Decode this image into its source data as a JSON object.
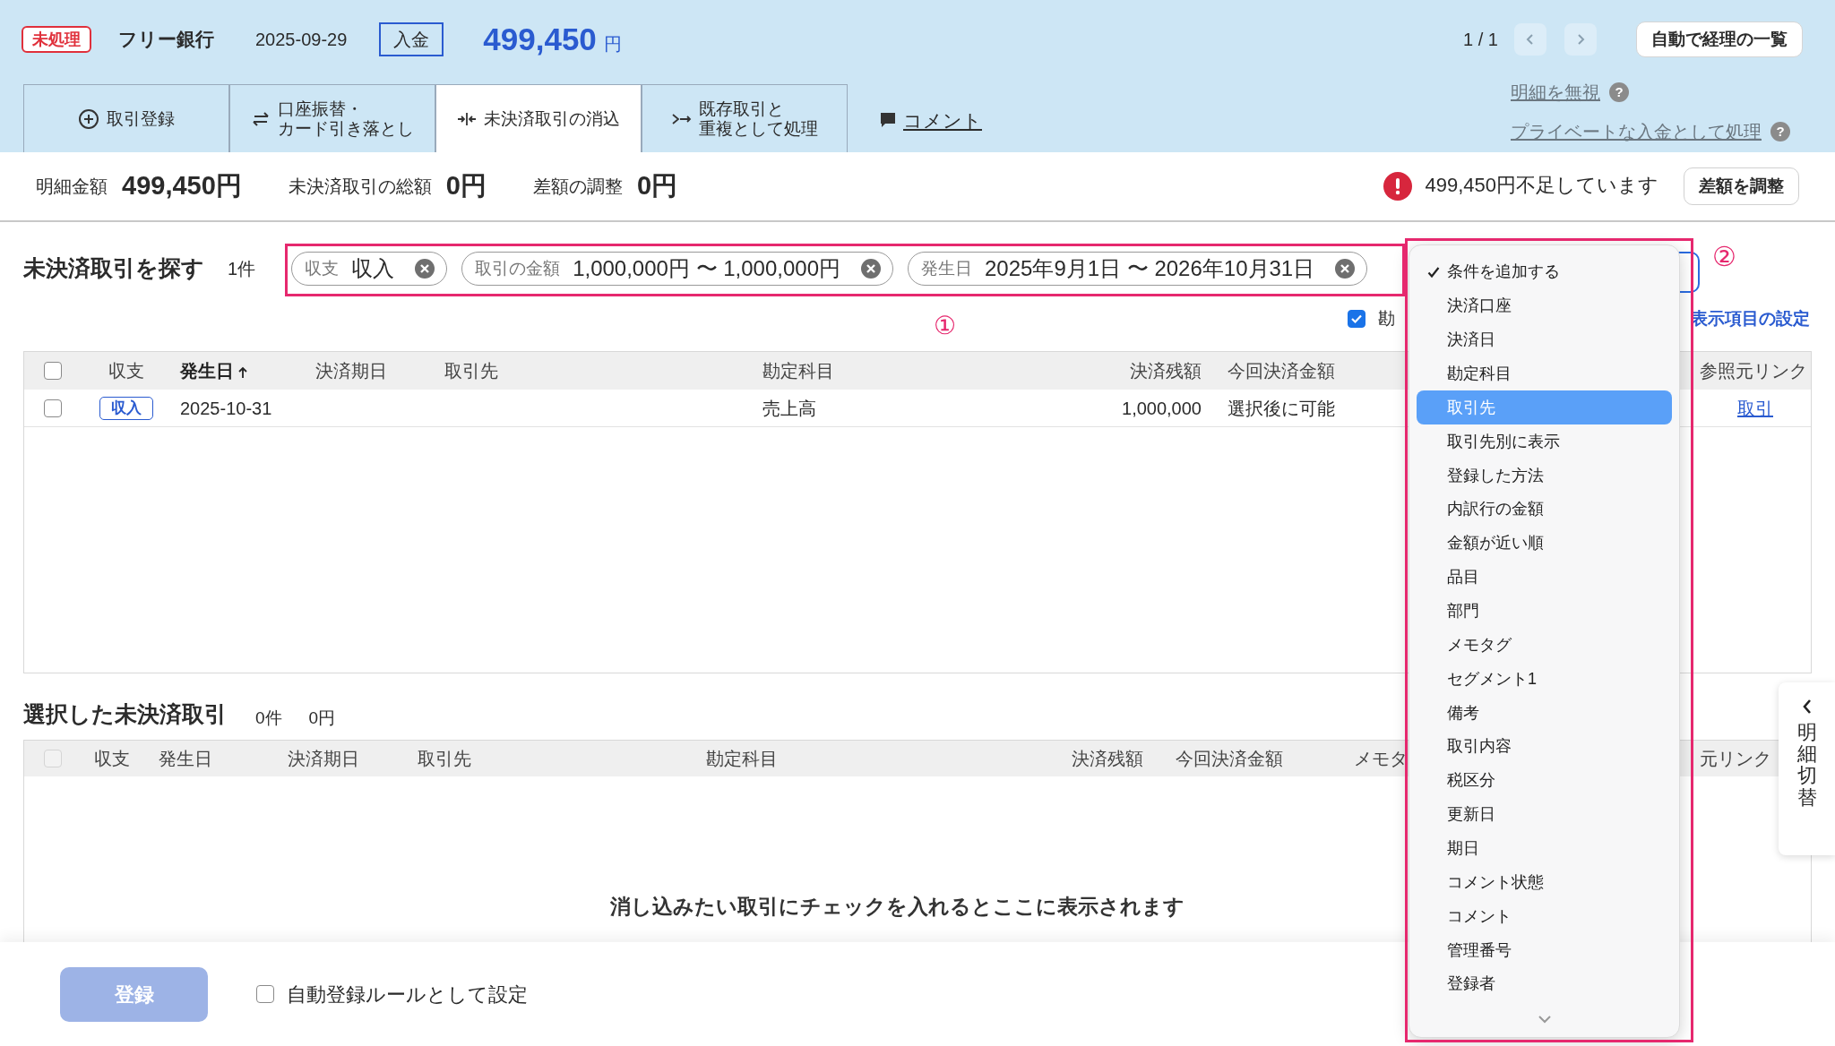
{
  "header": {
    "status_badge": "未処理",
    "bank": "フリー銀行",
    "date": "2025-09-29",
    "type_badge": "入金",
    "amount": "499,450",
    "currency": "円",
    "pager": "1 / 1",
    "list_button": "自動で経理の一覧"
  },
  "tabs": [
    {
      "lines": [
        "取引登録"
      ],
      "kind": "plus",
      "selected": false
    },
    {
      "lines": [
        "口座振替・",
        "カード引き落とし"
      ],
      "kind": "swap",
      "selected": false
    },
    {
      "lines": [
        "未決済取引の消込"
      ],
      "kind": "merge",
      "selected": true
    },
    {
      "lines": [
        "既存取引と",
        "重複として処理"
      ],
      "kind": "split",
      "selected": false
    }
  ],
  "comment_link": "コメント",
  "side_links": [
    {
      "label": "明細を無視",
      "help": "?"
    },
    {
      "label": "プライベートな入金として処理",
      "help": "?"
    }
  ],
  "summary": {
    "items": [
      {
        "label": "明細金額",
        "value": "499,450円"
      },
      {
        "label": "未決済取引の総額",
        "value": "0円"
      },
      {
        "label": "差額の調整",
        "value": "0円"
      }
    ],
    "warning": "499,450円不足しています",
    "adjust_button": "差額を調整"
  },
  "search": {
    "title": "未決済取引を探す",
    "count": "1件",
    "chips": [
      {
        "label": "収支",
        "value": "収入"
      },
      {
        "label": "取引の金額",
        "value": "1,000,000円 〜 1,000,000円"
      },
      {
        "label": "発生日",
        "value": "2025年9月1日 〜 2026年10月31日"
      }
    ],
    "filter_checkbox": {
      "label": "勘",
      "checked": true
    },
    "settings_link": "表示項目の設定"
  },
  "annotations": [
    {
      "label": "①"
    },
    {
      "label": "②"
    }
  ],
  "table1": {
    "select_all": {
      "checked": false,
      "disabled": false
    },
    "columns": [
      {
        "label": "収支",
        "sorted": false
      },
      {
        "label": "発生日",
        "sorted": true
      },
      {
        "label": "決済期日",
        "sorted": false
      },
      {
        "label": "取引先",
        "sorted": false
      },
      {
        "label": "勘定科目",
        "sorted": false
      },
      {
        "label": "決済残額",
        "sorted": false
      },
      {
        "label": "今回決済金額",
        "sorted": false
      },
      {
        "label": "参照元リンク",
        "sorted": false
      }
    ],
    "rows": [
      {
        "checked": false,
        "type_badge": "収入",
        "date": "2025-10-31",
        "account": "売上高",
        "balance": "1,000,000",
        "amount": "選択後に可能",
        "link": "取引"
      }
    ]
  },
  "selected": {
    "title": "選択した未決済取引",
    "count": "0件",
    "total": "0円",
    "select_all": {
      "checked": false,
      "disabled": true
    },
    "columns": [
      {
        "label": "収支"
      },
      {
        "label": "発生日"
      },
      {
        "label": "決済期日"
      },
      {
        "label": "取引先"
      },
      {
        "label": "勘定科目"
      },
      {
        "label": "決済残額"
      },
      {
        "label": "今回決済金額"
      },
      {
        "label": "メモタ"
      },
      {
        "label": "元リンク"
      }
    ],
    "empty_message": "消し込みたい取引にチェックを入れるとここに表示されます"
  },
  "footer": {
    "submit_button": "登録",
    "submit_disabled": true,
    "rule_checkbox": {
      "label": "自動登録ルールとして設定",
      "checked": false
    }
  },
  "side_tab": {
    "label": "明細切替"
  },
  "dropdown": {
    "items": [
      {
        "label": "条件を追加する",
        "checked": true,
        "selected": false
      },
      {
        "label": "決済口座",
        "checked": false,
        "selected": false
      },
      {
        "label": "決済日",
        "checked": false,
        "selected": false
      },
      {
        "label": "勘定科目",
        "checked": false,
        "selected": false
      },
      {
        "label": "取引先",
        "checked": false,
        "selected": true
      },
      {
        "label": "取引先別に表示",
        "checked": false,
        "selected": false
      },
      {
        "label": "登録した方法",
        "checked": false,
        "selected": false
      },
      {
        "label": "内訳行の金額",
        "checked": false,
        "selected": false
      },
      {
        "label": "金額が近い順",
        "checked": false,
        "selected": false
      },
      {
        "label": "品目",
        "checked": false,
        "selected": false
      },
      {
        "label": "部門",
        "checked": false,
        "selected": false
      },
      {
        "label": "メモタグ",
        "checked": false,
        "selected": false
      },
      {
        "label": "セグメント1",
        "checked": false,
        "selected": false
      },
      {
        "label": "備考",
        "checked": false,
        "selected": false
      },
      {
        "label": "取引内容",
        "checked": false,
        "selected": false
      },
      {
        "label": "税区分",
        "checked": false,
        "selected": false
      },
      {
        "label": "更新日",
        "checked": false,
        "selected": false
      },
      {
        "label": "期日",
        "checked": false,
        "selected": false
      },
      {
        "label": "コメント状態",
        "checked": false,
        "selected": false
      },
      {
        "label": "コメント",
        "checked": false,
        "selected": false
      },
      {
        "label": "管理番号",
        "checked": false,
        "selected": false
      },
      {
        "label": "登録者",
        "checked": false,
        "selected": false
      }
    ]
  }
}
